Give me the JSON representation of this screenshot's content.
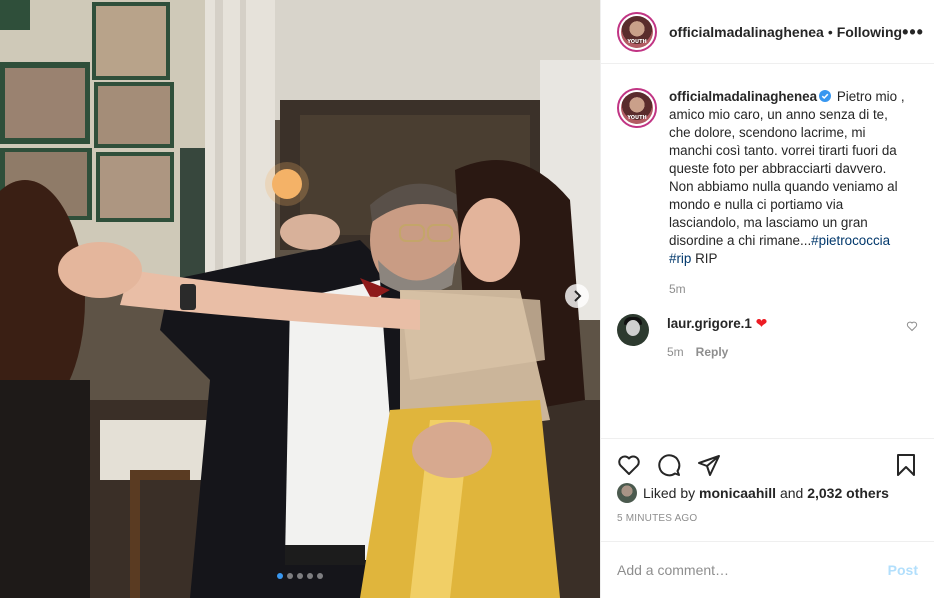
{
  "photo": {
    "carousel_dots": 5,
    "active_dot": 0,
    "next_icon": "chevron-right-icon"
  },
  "header": {
    "username": "officialmadalinaghenea",
    "separator": "•",
    "follow_label": "Following",
    "more_label": "•••",
    "avatar_tag": "YOUTH"
  },
  "caption": {
    "username": "officialmadalinaghenea",
    "text": "Pietro mio , amico mio caro, un anno senza di te, che dolore, scendono lacrime, mi manchi così tanto. vorrei tirarti fuori da queste foto per abbracciarti davvero. Non abbiamo nulla quando veniamo al mondo e nulla ci portiamo via lasciandolo, ma lasciamo un gran disordine a chi rimane...",
    "hashtag1": "#pietrococcia",
    "hashtag2": "#rip",
    "tail": "RIP",
    "time": "5m"
  },
  "comments": [
    {
      "username": "laur.grigore.1",
      "emoji": "❤",
      "time": "5m",
      "reply_label": "Reply"
    }
  ],
  "actions": {
    "icons": [
      "heart-icon",
      "comment-icon",
      "share-icon",
      "bookmark-icon"
    ]
  },
  "likes": {
    "prefix": "Liked by",
    "user": "monicaahill",
    "and": "and",
    "others": "2,032 others"
  },
  "posted": "5 MINUTES AGO",
  "add_comment": {
    "placeholder": "Add a comment…",
    "post_label": "Post"
  },
  "colors": {
    "link": "#00376b",
    "verified": "#3897f0",
    "post_disabled": "#b2dffc",
    "muted": "#8e8e8e"
  }
}
